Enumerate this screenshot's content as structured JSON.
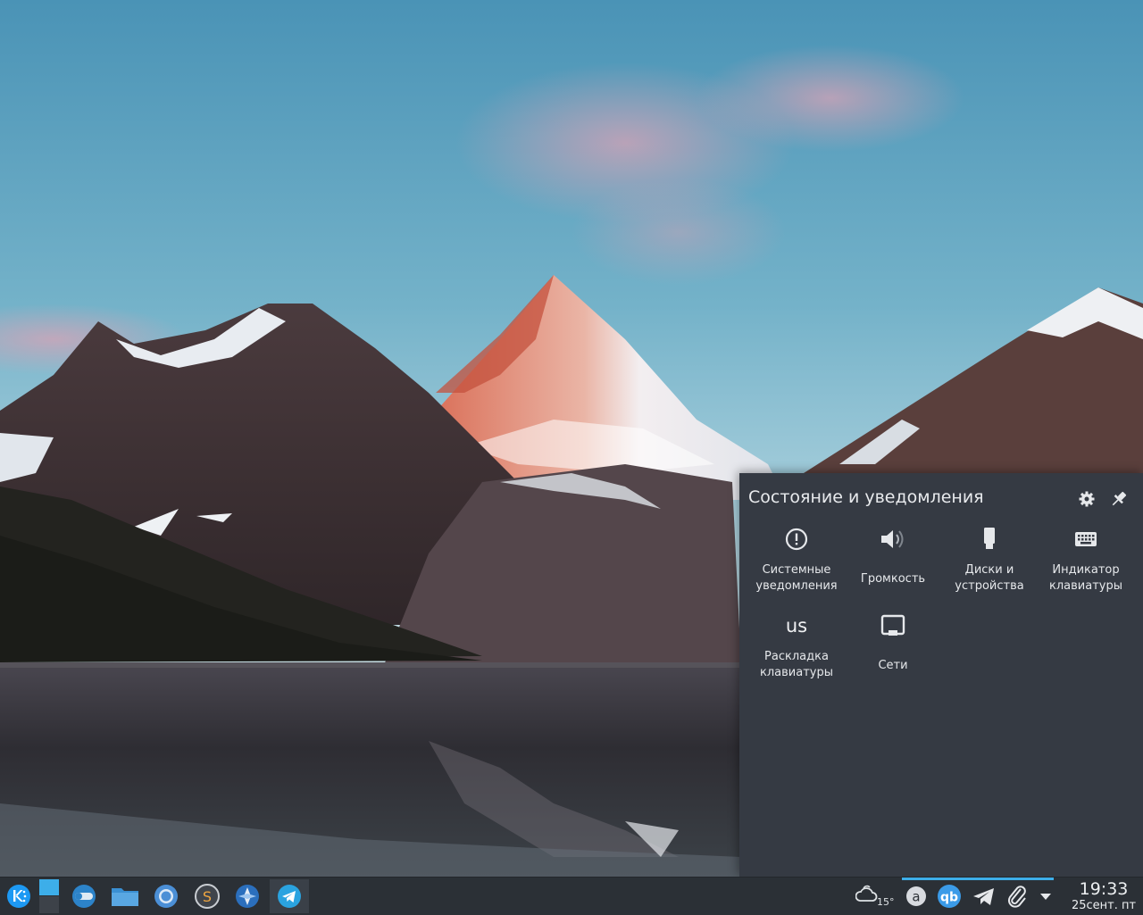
{
  "popup": {
    "title": "Состояние и уведомления",
    "settings_icon": "gear-icon",
    "pin_icon": "pin-icon",
    "items": [
      {
        "label": "Системные\nуведомления",
        "icon": "notifications-icon"
      },
      {
        "label": "Громкость",
        "icon": "volume-icon"
      },
      {
        "label": "Диски и\nустройства",
        "icon": "usb-drive-icon"
      },
      {
        "label": "Индикатор\nклавиатуры",
        "icon": "keyboard-icon"
      },
      {
        "label": "Раскладка\nклавиатуры",
        "icon": "keyboard-layout-icon",
        "icon_text": "us"
      },
      {
        "label": "Сети",
        "icon": "network-icon"
      }
    ]
  },
  "taskbar": {
    "launchers": [
      {
        "name": "application-launcher",
        "icon": "kde-icon"
      },
      {
        "name": "pager",
        "icon": "virtual-desktop-icon"
      },
      {
        "name": "system-settings",
        "icon": "toggle-icon"
      },
      {
        "name": "file-manager",
        "icon": "folder-icon"
      },
      {
        "name": "chromium",
        "icon": "chromium-icon"
      },
      {
        "name": "sublime-text",
        "icon": "sublime-icon"
      },
      {
        "name": "compass-app",
        "icon": "compass-icon"
      },
      {
        "name": "telegram",
        "icon": "telegram-icon"
      }
    ],
    "tray": {
      "weather_temp": "15°",
      "icons": [
        "weather-icon",
        "text-a-icon",
        "qbittorrent-icon",
        "telegram-tray-icon",
        "paperclip-icon",
        "expand-arrow-icon"
      ]
    },
    "clock": {
      "time": "19:33",
      "date": "25сент. пт"
    }
  },
  "colors": {
    "accent": "#3daee9",
    "popup_bg": "#353a43",
    "taskbar_bg": "#2b3036"
  }
}
